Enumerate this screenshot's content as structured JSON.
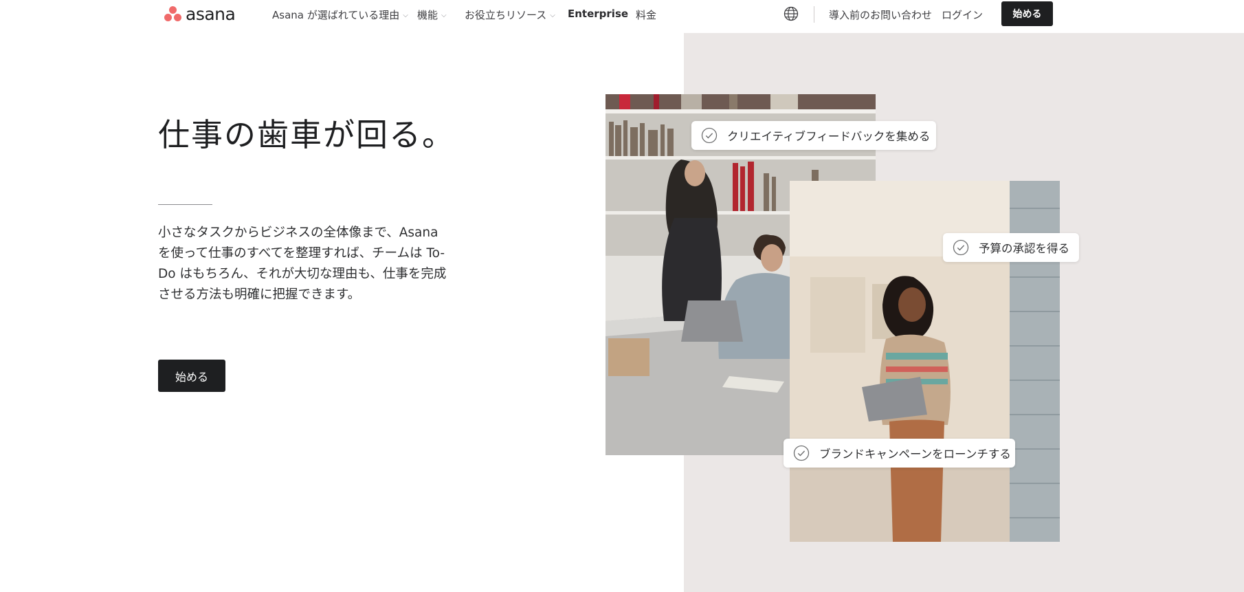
{
  "brand": {
    "name": "asana",
    "colors": {
      "accent": "#f06a6a",
      "dark": "#1e1f21",
      "panel_bg": "#ebe7e6"
    }
  },
  "nav": {
    "items": [
      {
        "label": "Asana が選ばれている理由",
        "has_dropdown": true
      },
      {
        "label": "機能",
        "has_dropdown": true
      },
      {
        "label": "お役立ちリソース",
        "has_dropdown": true
      },
      {
        "label": "Enterprise",
        "has_dropdown": false
      },
      {
        "label": "料金",
        "has_dropdown": false
      }
    ],
    "globe_icon": "globe-icon",
    "contact_label": "導入前のお問い合わせ",
    "login_label": "ログイン",
    "start_label": "始める"
  },
  "hero": {
    "title": "仕事の歯車が回る。",
    "description": "小さなタスクからビジネスの全体像まで、Asana を使って仕事のすべてを整理すれば、チームは To-Do はもちろん、それが大切な理由も、仕事を完成させる方法も明確に把握できます。",
    "cta_label": "始める"
  },
  "cards": [
    {
      "label": "クリエイティブフィードバックを集める",
      "icon": "check-circle-icon"
    },
    {
      "label": "予算の承認を得る",
      "icon": "check-circle-icon"
    },
    {
      "label": "ブランドキャンペーンをローンチする",
      "icon": "check-circle-icon"
    }
  ]
}
